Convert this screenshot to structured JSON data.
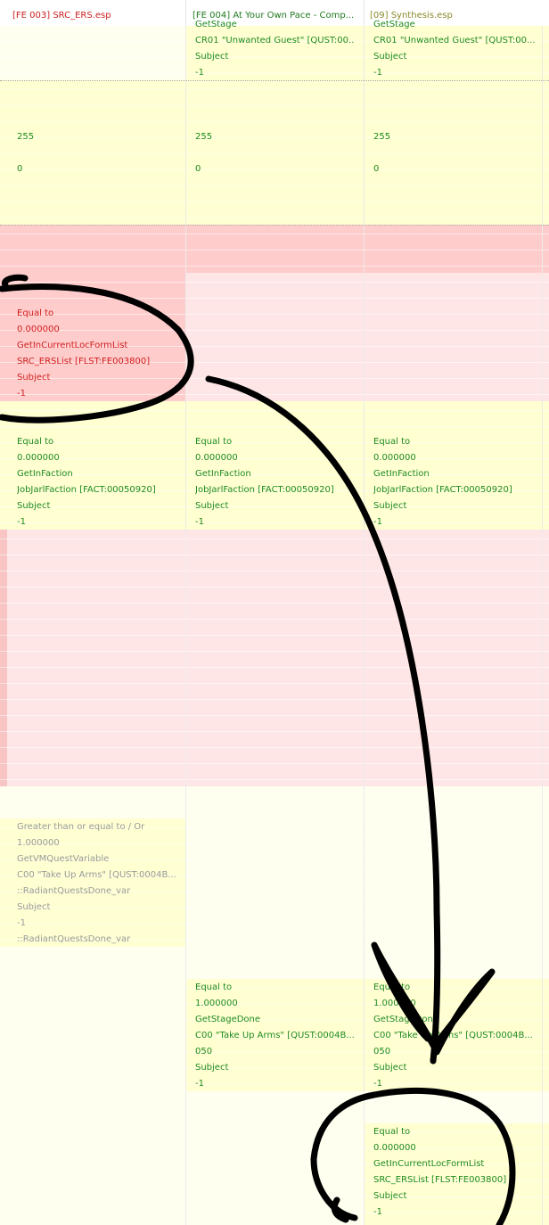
{
  "colors": {
    "header_red": "#cc1f1f",
    "header_green": "#1e7a1e",
    "header_olive": "#8a8a2a",
    "text_green": "#1e8a1e",
    "text_red": "#d01c1c",
    "text_gray": "#9a9a9a",
    "bg_white": "#ffffff",
    "bg_yellow": "#ffffd2",
    "bg_pale_yellow": "#fffff0",
    "bg_red": "#ffcccc",
    "bg_pink": "#ffe6e6",
    "bg_pale_pink": "#ffeeee",
    "bg_red_strip": "#f9c4c4"
  },
  "columns": [
    {
      "label": "[FE 003] SRC_ERS.esp"
    },
    {
      "label": "[FE 004] At Your Own Pace - Comp..."
    },
    {
      "label": "[09] Synthesis.esp"
    }
  ],
  "blocks": [
    {
      "col": 1,
      "lines": [
        "GetStage",
        "CR01 \"Unwanted Guest\" [QUST:00...",
        "Subject",
        "-1"
      ]
    },
    {
      "col": 2,
      "lines": [
        "GetStage",
        "CR01 \"Unwanted Guest\" [QUST:00...",
        "Subject",
        "-1"
      ]
    },
    {
      "col": 0,
      "lines": [
        "255",
        "",
        "0"
      ]
    },
    {
      "col": 1,
      "lines": [
        "255",
        "",
        "0"
      ]
    },
    {
      "col": 2,
      "lines": [
        "255",
        "",
        "0"
      ]
    },
    {
      "col": 0,
      "lines": [
        "Equal to",
        "0.000000",
        "GetInCurrentLocFormList",
        "SRC_ERSList [FLST:FE003800]",
        "Subject",
        "-1"
      ]
    },
    {
      "col": 0,
      "lines": [
        "Equal to",
        "0.000000",
        "GetInFaction",
        "JobJarlFaction [FACT:00050920]",
        "Subject",
        "-1"
      ]
    },
    {
      "col": 1,
      "lines": [
        "Equal to",
        "0.000000",
        "GetInFaction",
        "JobJarlFaction [FACT:00050920]",
        "Subject",
        "-1"
      ]
    },
    {
      "col": 2,
      "lines": [
        "Equal to",
        "0.000000",
        "GetInFaction",
        "JobJarlFaction [FACT:00050920]",
        "Subject",
        "-1"
      ]
    },
    {
      "col": 0,
      "lines": [
        "Greater than or equal to / Or",
        "1.000000",
        "GetVMQuestVariable",
        "C00 \"Take Up Arms\" [QUST:0004B...",
        "::RadiantQuestsDone_var",
        "Subject",
        "-1",
        "::RadiantQuestsDone_var"
      ]
    },
    {
      "col": 1,
      "lines": [
        "Equal to",
        "1.000000",
        "GetStageDone",
        "C00 \"Take Up Arms\" [QUST:0004B...",
        "050",
        "Subject",
        "-1"
      ]
    },
    {
      "col": 2,
      "lines": [
        "Equal to",
        "1.000000",
        "GetStageDone",
        "C00 \"Take Up Arms\" [QUST:0004B...",
        "050",
        "Subject",
        "-1"
      ]
    },
    {
      "col": 2,
      "lines": [
        "Equal to",
        "0.000000",
        "GetInCurrentLocFormList",
        "SRC_ERSList [FLST:FE003800]",
        "Subject",
        "-1"
      ]
    }
  ]
}
